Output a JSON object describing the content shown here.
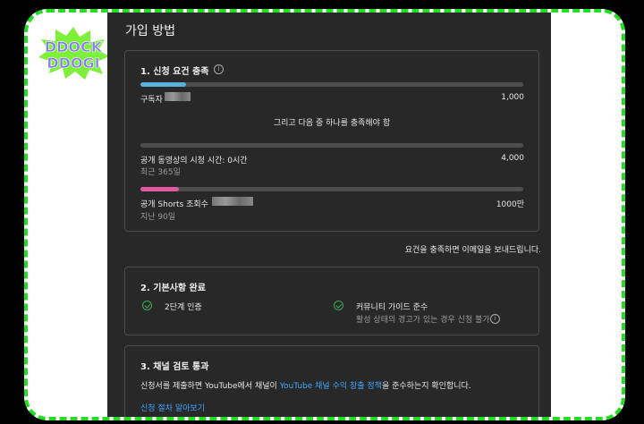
{
  "logo": {
    "line1": "DDOCK",
    "line2": "DDOGI"
  },
  "colors": {
    "frame_dash": "#22dd22",
    "panel_bg": "#282828",
    "subscribers_bar": "#5aafdc",
    "shorts_bar": "#e05aa0",
    "check": "#3aa757",
    "link": "#3ea6ff",
    "logo_burst": "#7ef03a",
    "logo_text": "#8a7cf0"
  },
  "page": {
    "title": "가입 방법"
  },
  "req": {
    "title": "1. 신청 요건 충족",
    "subscribers": {
      "label": "구독자",
      "target": "1,000",
      "progress": 0.12
    },
    "middle_text": "그리고 다음 중 하나를 충족해야 함",
    "watch": {
      "label": "공개 동영상의 시청 시간: 0시간",
      "period": "최근 365일",
      "target": "4,000",
      "progress": 0
    },
    "shorts": {
      "label": "공개 Shorts 조회수",
      "period": "지난 90일",
      "target": "1000만",
      "progress": 0.1
    }
  },
  "notify_text": "요건을 충족하면 이메일을 보내드립니다.",
  "basics": {
    "title": "2. 기본사항 완료",
    "two_step": "2단계 인증",
    "guidelines": "커뮤니티 가이드 준수",
    "guidelines_sub": "활성 상태의 경고가 있는 경우 신청 불가"
  },
  "review": {
    "title": "3. 채널 검토 통과",
    "desc_prefix": "신청서를 제출하면 YouTube에서 채널이 ",
    "desc_link": "YouTube 채널 수익 창출 정책",
    "desc_suffix": "을 준수하는지 확인합니다.",
    "learn_link": "신청 절차 알아보기"
  }
}
